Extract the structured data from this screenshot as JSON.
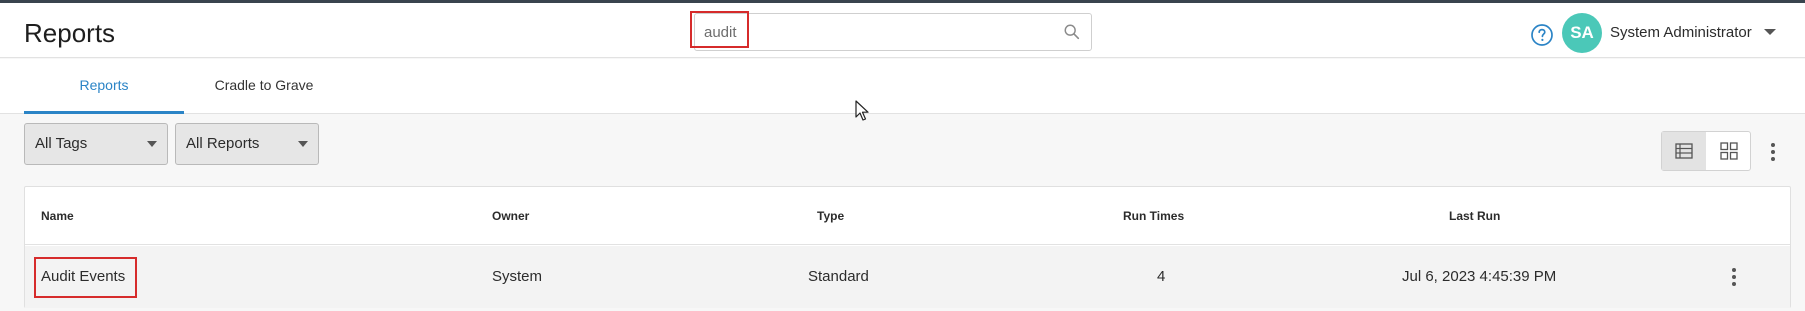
{
  "header": {
    "title": "Reports",
    "search": {
      "value": "audit",
      "placeholder": ""
    },
    "user": {
      "initials": "SA",
      "name": "System Administrator"
    }
  },
  "tabs": [
    {
      "label": "Reports",
      "active": true
    },
    {
      "label": "Cradle to Grave",
      "active": false
    }
  ],
  "filters": {
    "tags": "All Tags",
    "reports": "All Reports"
  },
  "table": {
    "columns": {
      "name": "Name",
      "owner": "Owner",
      "type": "Type",
      "run_times": "Run Times",
      "last_run": "Last Run"
    },
    "rows": [
      {
        "name": "Audit Events",
        "owner": "System",
        "type": "Standard",
        "run_times": "4",
        "last_run": "Jul 6, 2023 4:45:39 PM"
      }
    ]
  },
  "colors": {
    "accent": "#2b84c6",
    "avatar": "#4bc8b8",
    "highlight": "#d62b2b",
    "top_strip": "#39444e"
  },
  "icons": {
    "search": "search-icon",
    "help": "help-circle-icon",
    "user_menu": "chevron-down-icon",
    "list_view": "list-view-icon",
    "grid_view": "grid-view-icon",
    "more": "more-vertical-icon",
    "cursor": "mouse-cursor-icon"
  }
}
